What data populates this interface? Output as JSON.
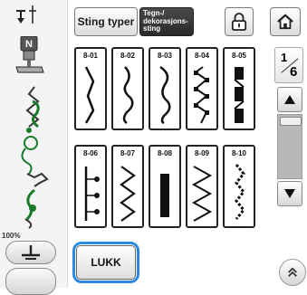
{
  "toolbar": {
    "sting_typer_label": "Sting typer",
    "tegn_label_lines": [
      "Tegn-/",
      "dekorasjons-",
      "sting"
    ]
  },
  "left_panel": {
    "presser_foot_letter": "N",
    "zoom_label": "100%"
  },
  "stitches": [
    {
      "code": "8-01",
      "icon": "zigzag-wave-stitch-icon"
    },
    {
      "code": "8-02",
      "icon": "scallop-wave-stitch-icon"
    },
    {
      "code": "8-03",
      "icon": "serpentine-stitch-icon"
    },
    {
      "code": "8-04",
      "icon": "square-step-stitch-icon"
    },
    {
      "code": "8-05",
      "icon": "block-satin-stitch-icon"
    },
    {
      "code": "8-06",
      "icon": "dotted-branch-stitch-icon"
    },
    {
      "code": "8-07",
      "icon": "zigzag-stitch-icon"
    },
    {
      "code": "8-08",
      "icon": "satin-bar-stitch-icon"
    },
    {
      "code": "8-09",
      "icon": "wide-zigzag-stitch-icon"
    },
    {
      "code": "8-10",
      "icon": "dotted-zigzag-stitch-icon"
    }
  ],
  "pager": {
    "current_page": "1",
    "total_pages": "6"
  },
  "bottom": {
    "close_label": "LUKK"
  },
  "colors": {
    "accent_highlight": "#2a8be0"
  }
}
